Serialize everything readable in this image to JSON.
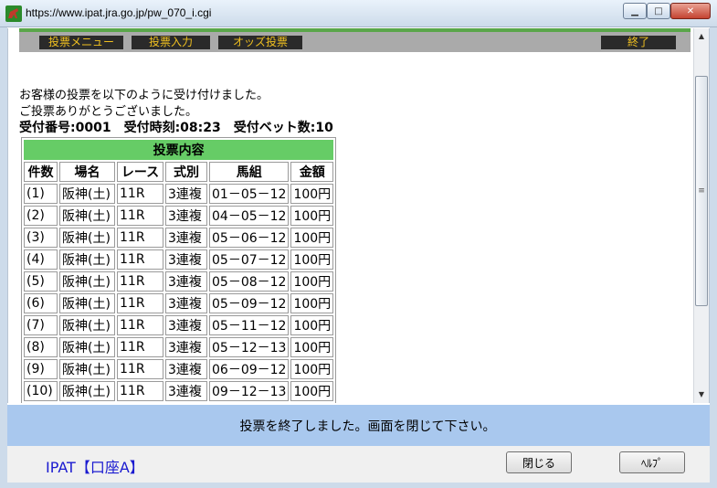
{
  "window": {
    "title": "https://www.ipat.jra.go.jp/pw_070_i.cgi",
    "minimize_glyph": "▁",
    "maximize_glyph": "□",
    "close_glyph": "✕"
  },
  "menu": {
    "items": [
      "投票メニュー",
      "投票入力",
      "オッズ投票"
    ],
    "end_label": "終了"
  },
  "message": {
    "line1": "お客様の投票を以下のように受け付けました。",
    "line2": "ご投票ありがとうございました。",
    "receipt": "受付番号:0001　受付時刻:08:23　受付ベット数:10"
  },
  "table": {
    "caption": "投票内容",
    "headers": [
      "件数",
      "場名",
      "レース",
      "式別",
      "馬組",
      "金額"
    ],
    "rows": [
      [
        "(1)",
        "阪神(土)",
        "11R",
        "3連複",
        "01－05－12",
        "100円"
      ],
      [
        "(2)",
        "阪神(土)",
        "11R",
        "3連複",
        "04－05－12",
        "100円"
      ],
      [
        "(3)",
        "阪神(土)",
        "11R",
        "3連複",
        "05－06－12",
        "100円"
      ],
      [
        "(4)",
        "阪神(土)",
        "11R",
        "3連複",
        "05－07－12",
        "100円"
      ],
      [
        "(5)",
        "阪神(土)",
        "11R",
        "3連複",
        "05－08－12",
        "100円"
      ],
      [
        "(6)",
        "阪神(土)",
        "11R",
        "3連複",
        "05－09－12",
        "100円"
      ],
      [
        "(7)",
        "阪神(土)",
        "11R",
        "3連複",
        "05－11－12",
        "100円"
      ],
      [
        "(8)",
        "阪神(土)",
        "11R",
        "3連複",
        "05－12－13",
        "100円"
      ],
      [
        "(9)",
        "阪神(土)",
        "11R",
        "3連複",
        "06－09－12",
        "100円"
      ],
      [
        "(10)",
        "阪神(土)",
        "11R",
        "3連複",
        "09－12－13",
        "100円"
      ]
    ]
  },
  "status": {
    "text": "投票を終了しました。画面を閉じて下さい。"
  },
  "footer": {
    "account": "IPAT【口座A】",
    "close_label": "閉じる",
    "help_label": "ﾍﾙﾌﾟ"
  },
  "colors": {
    "menu_bg": "#2a2a2a",
    "menu_text": "#f0c020",
    "caption_green": "#66cc66",
    "status_blue": "#a9c8ee",
    "account_blue": "#1a1ad0"
  },
  "icons": {
    "app": "horse-icon",
    "scroll_up": "arrow-up-icon",
    "scroll_down": "arrow-down-icon"
  }
}
